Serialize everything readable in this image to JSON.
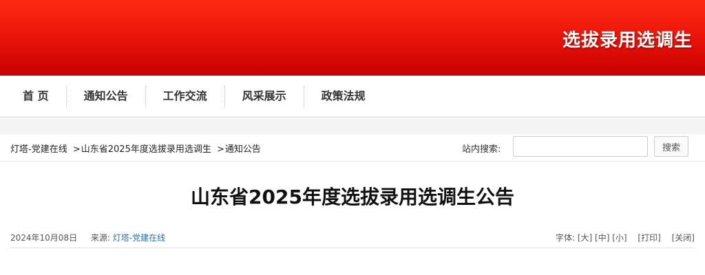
{
  "banner": {
    "title": "选拔录用选调生"
  },
  "nav": {
    "items": [
      "首 页",
      "通知公告",
      "工作交流",
      "风采展示",
      "政策法规"
    ]
  },
  "breadcrumb": {
    "items": [
      "灯塔-党建在线",
      "山东省2025年度选拔录用选调生",
      "通知公告"
    ],
    "separator": ">"
  },
  "search": {
    "label": "站内搜索:",
    "placeholder": "",
    "button_label": "搜索"
  },
  "article": {
    "title": "山东省2025年度选拔录用选调生公告",
    "date": "2024年10月08日",
    "source_label": "来源:",
    "source_value": "灯塔-党建在线"
  },
  "tools": {
    "font_label": "字体:",
    "font_large": "[大]",
    "font_medium": "[中]",
    "font_small": "[小]",
    "print": "[打印]",
    "close": "[关闭]"
  },
  "colors": {
    "banner_red": "#e8140a",
    "link_blue": "#2d6fb3"
  }
}
